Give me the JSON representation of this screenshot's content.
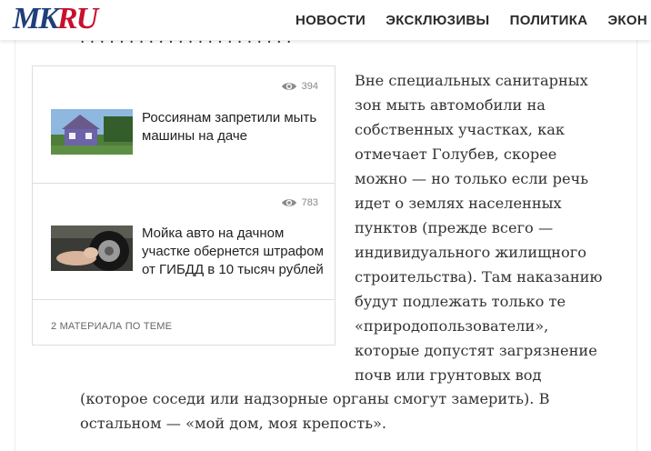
{
  "header": {
    "logo": {
      "mk": "MK",
      "ru": "RU"
    },
    "nav": [
      "НОВОСТИ",
      "ЭКСКЛЮЗИВЫ",
      "ПОЛИТИКА",
      "ЭКОН"
    ]
  },
  "related": {
    "items": [
      {
        "views": "394",
        "title": "Россиянам запретили мыть машины на даче"
      },
      {
        "views": "783",
        "title": "Мойка авто на дачном участке обернется штрафом от ГИБДД в 10 тысяч рублей"
      }
    ],
    "footer": "2 МАТЕРИАЛА ПО ТЕМЕ"
  },
  "article": {
    "right_lines": [
      "Вне специальных санитарных",
      "зон мыть автомобили на",
      "собственных участках, как",
      "отмечает Голубев, скорее",
      "можно — но только если речь",
      "идет о землях населенных",
      "пунктов (прежде всего —",
      "индивидуального жилищного",
      "строительства). Там наказанию",
      "будут подлежать только те",
      "«природопользователи»,",
      "которые допустят загрязнение",
      "почв или грунтовых вод"
    ],
    "bottom_lines": [
      "(которое соседи или надзорные органы смогут замерить). В",
      "остальном — «мой дом, моя крепость»."
    ]
  }
}
